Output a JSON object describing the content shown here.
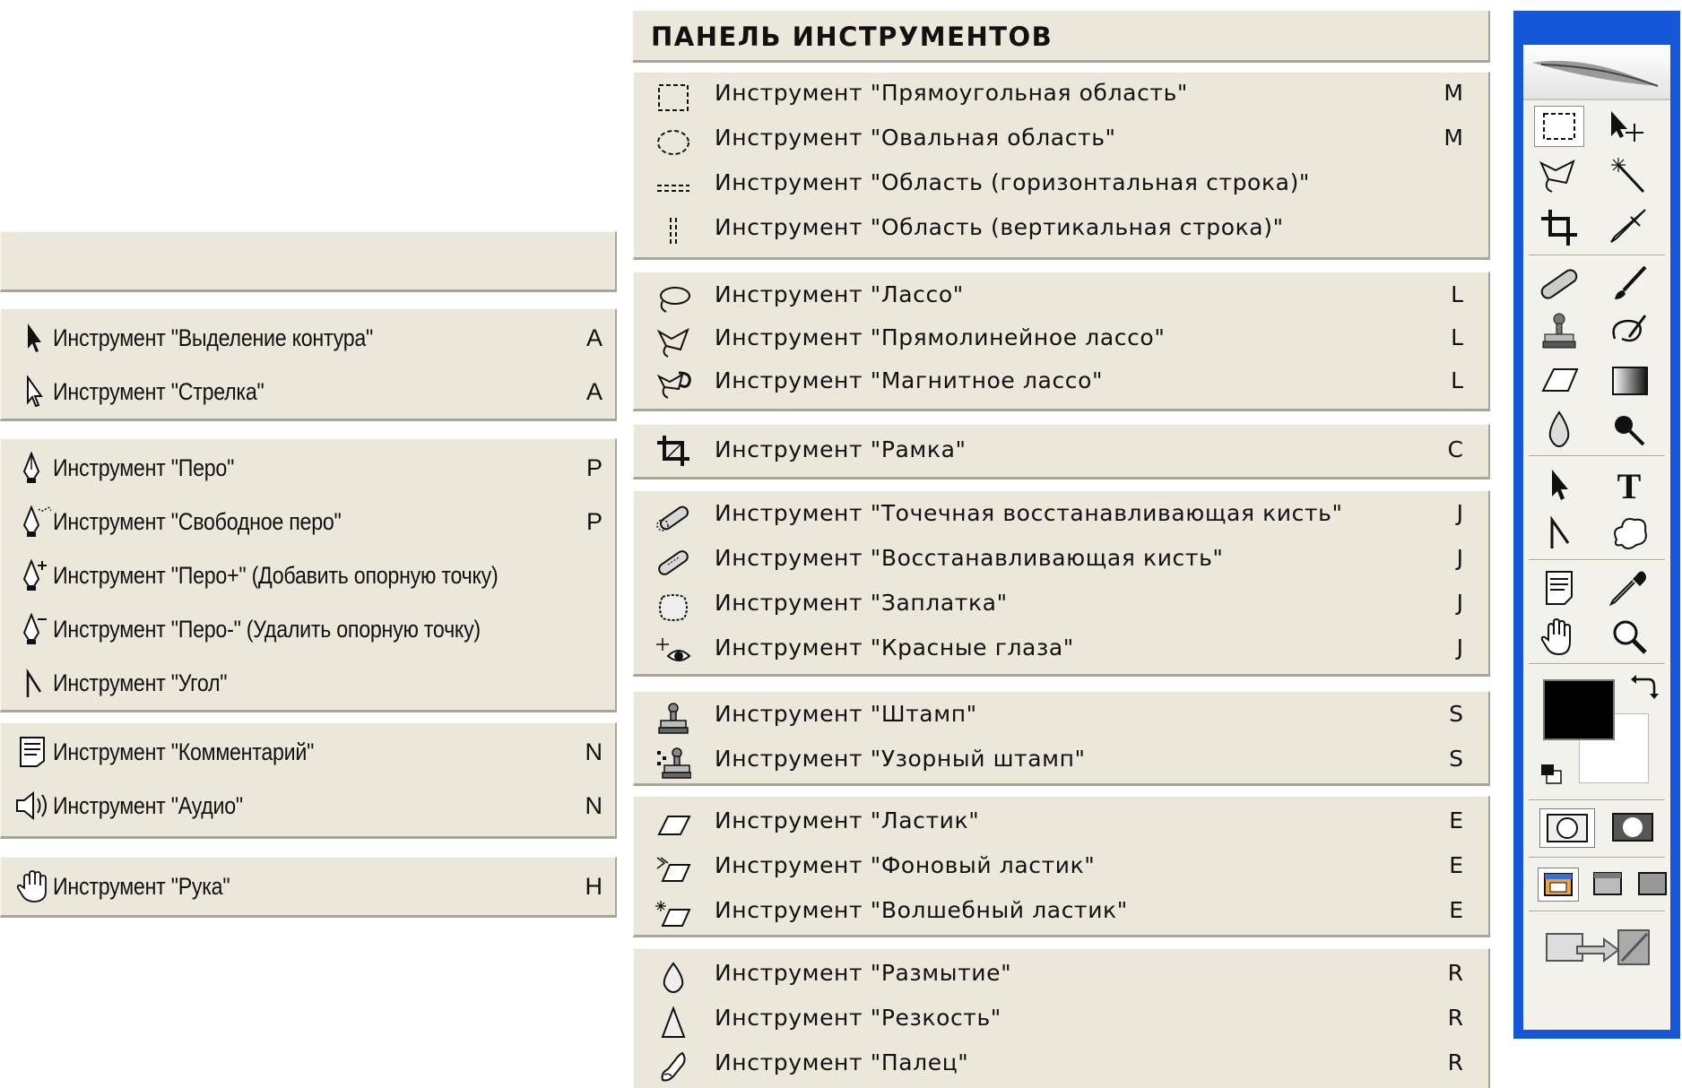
{
  "panel_title": "ПАНЕЛЬ ИНСТРУМЕНТОВ",
  "left_groups": [
    {
      "items": [
        {
          "label": "Инструмент \"Выделение контура\"",
          "key": "A",
          "icon": "path-selection-icon"
        },
        {
          "label": "Инструмент \"Стрелка\"",
          "key": "A",
          "icon": "direct-selection-icon"
        }
      ]
    },
    {
      "items": [
        {
          "label": "Инструмент \"Перо\"",
          "key": "P",
          "icon": "pen-icon"
        },
        {
          "label": "Инструмент \"Свободное перо\"",
          "key": "P",
          "icon": "freeform-pen-icon"
        },
        {
          "label": "Инструмент \"Перо+\" (Добавить опорную точку)",
          "key": "",
          "icon": "add-anchor-point-icon"
        },
        {
          "label": "Инструмент \"Перо-\" (Удалить опорную точку)",
          "key": "",
          "icon": "delete-anchor-point-icon"
        },
        {
          "label": "Инструмент \"Угол\"",
          "key": "",
          "icon": "convert-point-icon"
        }
      ]
    },
    {
      "items": [
        {
          "label": "Инструмент \"Комментарий\"",
          "key": "N",
          "icon": "notes-icon"
        },
        {
          "label": "Инструмент \"Аудио\"",
          "key": "N",
          "icon": "audio-annotation-icon"
        }
      ]
    },
    {
      "items": [
        {
          "label": "Инструмент \"Рука\"",
          "key": "H",
          "icon": "hand-icon"
        }
      ]
    }
  ],
  "right_groups": [
    {
      "items": [
        {
          "label": "Инструмент \"Прямоугольная область\"",
          "key": "M",
          "icon": "rectangular-marquee-icon"
        },
        {
          "label": "Инструмент \"Овальная область\"",
          "key": "M",
          "icon": "elliptical-marquee-icon"
        },
        {
          "label": "Инструмент \"Область (горизонтальная строка)\"",
          "key": "",
          "icon": "single-row-marquee-icon"
        },
        {
          "label": "Инструмент \"Область (вертикальная строка)\"",
          "key": "",
          "icon": "single-column-marquee-icon"
        }
      ]
    },
    {
      "items": [
        {
          "label": "Инструмент \"Лассо\"",
          "key": "L",
          "icon": "lasso-icon"
        },
        {
          "label": "Инструмент \"Прямолинейное лассо\"",
          "key": "L",
          "icon": "polygonal-lasso-icon"
        },
        {
          "label": "Инструмент \"Магнитное лассо\"",
          "key": "L",
          "icon": "magnetic-lasso-icon"
        }
      ]
    },
    {
      "items": [
        {
          "label": "Инструмент \"Рамка\"",
          "key": "C",
          "icon": "crop-icon"
        }
      ]
    },
    {
      "items": [
        {
          "label": "Инструмент \"Точечная восстанавливающая кисть\"",
          "key": "J",
          "icon": "spot-healing-brush-icon"
        },
        {
          "label": "Инструмент \"Восстанавливающая кисть\"",
          "key": "J",
          "icon": "healing-brush-icon"
        },
        {
          "label": "Инструмент \"Заплатка\"",
          "key": "J",
          "icon": "patch-icon"
        },
        {
          "label": "Инструмент \"Красные глаза\"",
          "key": "J",
          "icon": "red-eye-icon"
        }
      ]
    },
    {
      "items": [
        {
          "label": "Инструмент \"Штамп\"",
          "key": "S",
          "icon": "clone-stamp-icon"
        },
        {
          "label": "Инструмент \"Узорный штамп\"",
          "key": "S",
          "icon": "pattern-stamp-icon"
        }
      ]
    },
    {
      "items": [
        {
          "label": "Инструмент \"Ластик\"",
          "key": "E",
          "icon": "eraser-icon"
        },
        {
          "label": "Инструмент \"Фоновый ластик\"",
          "key": "E",
          "icon": "background-eraser-icon"
        },
        {
          "label": "Инструмент \"Волшебный ластик\"",
          "key": "E",
          "icon": "magic-eraser-icon"
        }
      ]
    },
    {
      "items": [
        {
          "label": "Инструмент \"Размытие\"",
          "key": "R",
          "icon": "blur-icon"
        },
        {
          "label": "Инструмент \"Резкость\"",
          "key": "R",
          "icon": "sharpen-icon"
        },
        {
          "label": "Инструмент \"Палец\"",
          "key": "R",
          "icon": "smudge-icon"
        }
      ]
    }
  ],
  "toolbox": {
    "tools": [
      "rectangular-marquee-icon",
      "move-icon",
      "lasso-icon",
      "magic-wand-icon",
      "crop-icon",
      "slice-icon",
      "healing-brush-icon",
      "brush-icon",
      "clone-stamp-icon",
      "history-brush-icon",
      "eraser-icon",
      "gradient-icon",
      "blur-icon",
      "dodge-icon",
      "path-selection-icon",
      "type-icon",
      "pen-icon",
      "custom-shape-icon",
      "notes-icon",
      "eyedropper-icon",
      "hand-icon",
      "zoom-icon"
    ],
    "type_glyph": "T",
    "foreground_color": "#000000",
    "background_color": "#ffffff",
    "title_bar_color": "#1656d8"
  }
}
